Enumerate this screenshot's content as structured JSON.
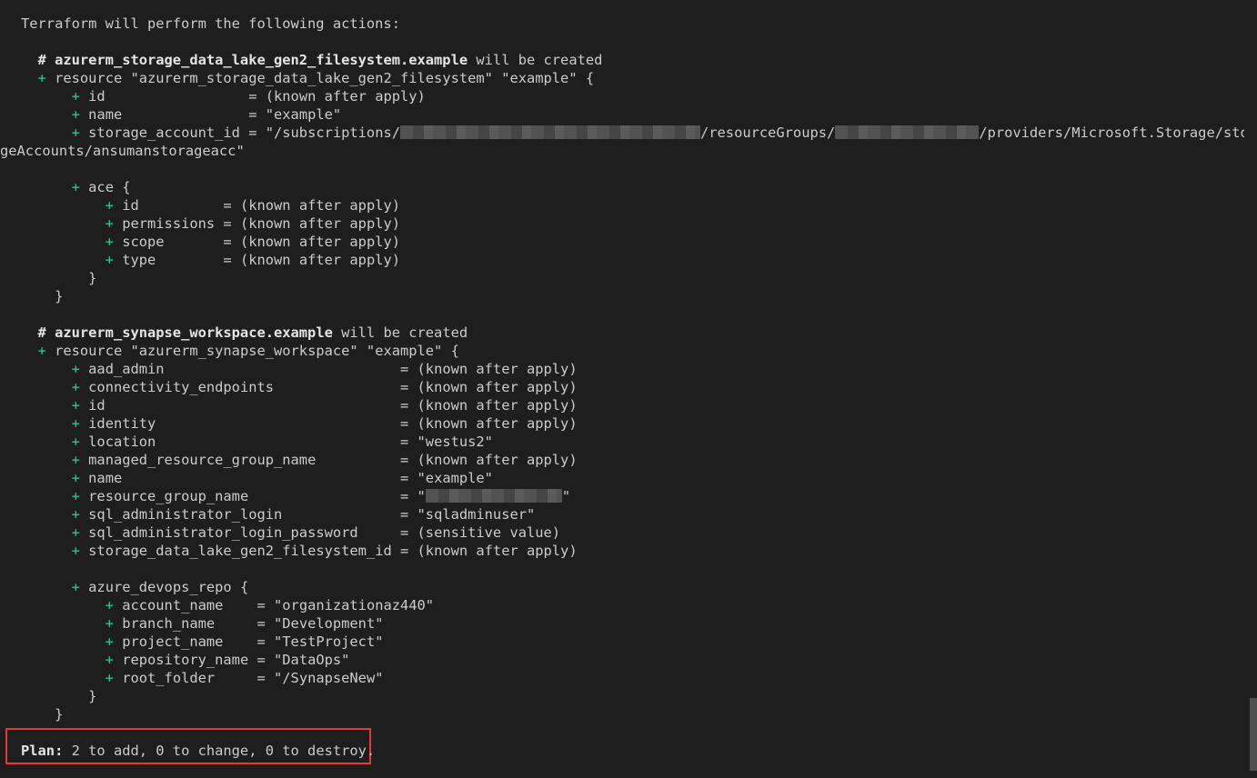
{
  "header": "Terraform will perform the following actions:",
  "storage": {
    "comment_name": "# azurerm_storage_data_lake_gen2_filesystem.example",
    "comment_suffix": " will be created",
    "resource_line": " resource \"azurerm_storage_data_lake_gen2_filesystem\" \"example\" {",
    "attrs": [
      {
        "key": " id                 ",
        "value": "= (known after apply)"
      },
      {
        "key": " name               ",
        "value": "= \"example\""
      }
    ],
    "account_prefix": " storage_account_id = \"/subscriptions/",
    "account_mid": "/resourceGroups/",
    "account_suffix": "/providers/Microsoft.Storage/stora",
    "account_wrap": "geAccounts/ansumanstorageacc\"",
    "ace_open": " ace {",
    "ace_attrs": [
      {
        "key": " id          ",
        "value": "= (known after apply)"
      },
      {
        "key": " permissions ",
        "value": "= (known after apply)"
      },
      {
        "key": " scope       ",
        "value": "= (known after apply)"
      },
      {
        "key": " type        ",
        "value": "= (known after apply)"
      }
    ],
    "ace_close": "}",
    "close": "}"
  },
  "synapse": {
    "comment_name": "# azurerm_synapse_workspace.example",
    "comment_suffix": " will be created",
    "resource_line": " resource \"azurerm_synapse_workspace\" \"example\" {",
    "attrs": [
      {
        "key": " aad_admin                            ",
        "value": "= (known after apply)"
      },
      {
        "key": " connectivity_endpoints               ",
        "value": "= (known after apply)"
      },
      {
        "key": " id                                   ",
        "value": "= (known after apply)"
      },
      {
        "key": " identity                             ",
        "value": "= (known after apply)"
      },
      {
        "key": " location                             ",
        "value": "= \"westus2\""
      },
      {
        "key": " managed_resource_group_name          ",
        "value": "= (known after apply)"
      },
      {
        "key": " name                                 ",
        "value": "= \"example\""
      }
    ],
    "rg_key": " resource_group_name                  ",
    "rg_value_prefix": "= \"",
    "rg_value_suffix": "\"",
    "attrs2": [
      {
        "key": " sql_administrator_login              ",
        "value": "= \"sqladminuser\""
      },
      {
        "key": " sql_administrator_login_password     ",
        "value": "= (sensitive value)"
      },
      {
        "key": " storage_data_lake_gen2_filesystem_id ",
        "value": "= (known after apply)"
      }
    ],
    "repo_open": " azure_devops_repo {",
    "repo_attrs": [
      {
        "key": " account_name    ",
        "value": "= \"organizationaz440\""
      },
      {
        "key": " branch_name     ",
        "value": "= \"Development\""
      },
      {
        "key": " project_name    ",
        "value": "= \"TestProject\""
      },
      {
        "key": " repository_name ",
        "value": "= \"DataOps\""
      },
      {
        "key": " root_folder     ",
        "value": "= \"/SynapseNew\""
      }
    ],
    "repo_close": "}",
    "close": "}"
  },
  "plan": {
    "label": "Plan:",
    "summary": " 2 to add, 0 to change, 0 to destroy."
  },
  "plus_sign": "+"
}
